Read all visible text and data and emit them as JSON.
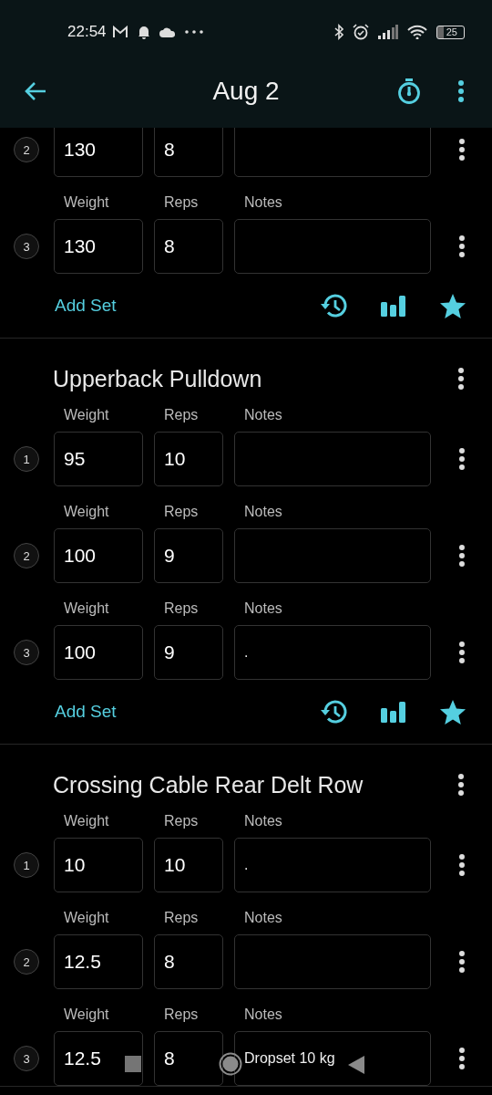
{
  "status_bar": {
    "time": "22:54",
    "battery": "25"
  },
  "app_bar": {
    "title": "Aug 2"
  },
  "exercises": [
    {
      "sets": [
        {
          "number": "2",
          "weight": "130",
          "reps": "8"
        },
        {
          "number": "3",
          "labels": [
            "Weight",
            "Reps",
            "Notes"
          ],
          "weight": "130",
          "reps": "8"
        }
      ],
      "add_set": "Add Set"
    },
    {
      "title": "Upperback Pulldown",
      "sets": [
        {
          "number": "1",
          "labels": [
            "Weight",
            "Reps",
            "Notes"
          ],
          "weight": "95",
          "reps": "10"
        },
        {
          "number": "2",
          "labels": [
            "Weight",
            "Reps",
            "Notes"
          ],
          "weight": "100",
          "reps": "9"
        },
        {
          "number": "3",
          "labels": [
            "Weight",
            "Reps",
            "Notes"
          ],
          "weight": "100",
          "reps": "9",
          "notes": "."
        }
      ],
      "add_set": "Add Set"
    },
    {
      "title": "Crossing Cable Rear Delt Row",
      "sets": [
        {
          "number": "1",
          "labels": [
            "Weight",
            "Reps",
            "Notes"
          ],
          "weight": "10",
          "reps": "10",
          "notes": "."
        },
        {
          "number": "2",
          "labels": [
            "Weight",
            "Reps",
            "Notes"
          ],
          "weight": "12.5",
          "reps": "8"
        },
        {
          "number": "3",
          "labels": [
            "Weight",
            "Reps",
            "Notes"
          ],
          "weight": "12.5",
          "reps": "8",
          "notes": "Dropset 10 kg"
        }
      ]
    }
  ]
}
